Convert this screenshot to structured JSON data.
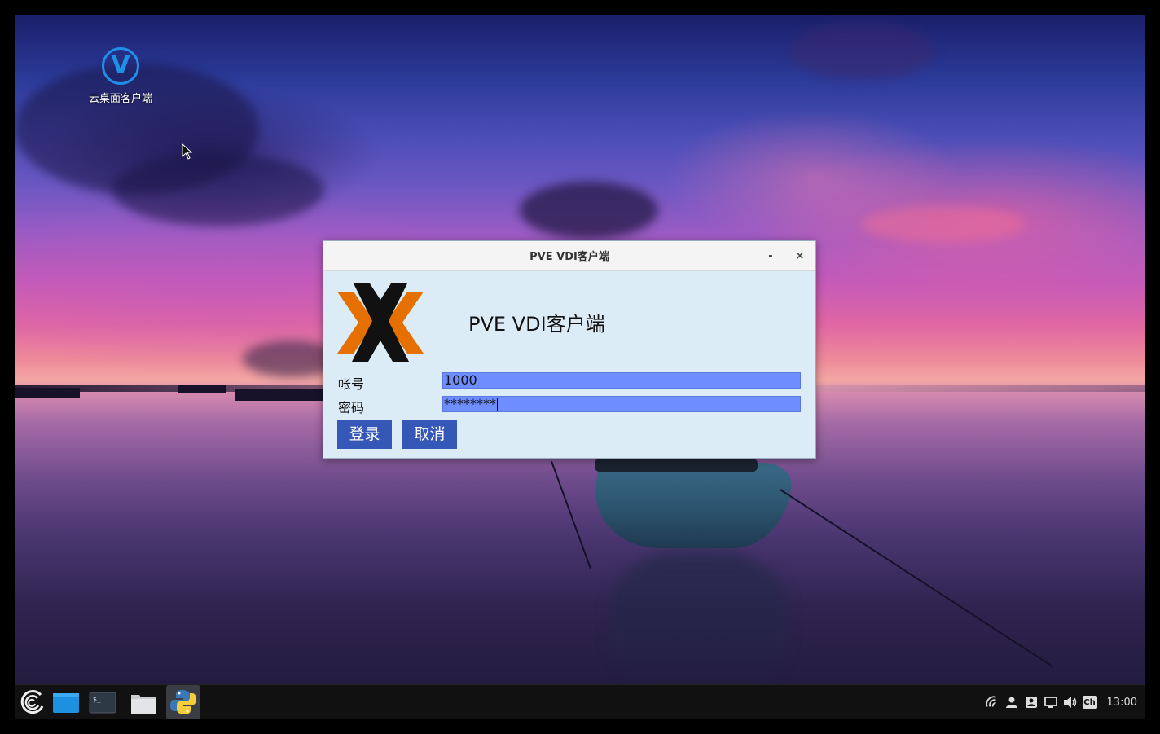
{
  "desktop": {
    "icon_label": "云桌面客户端",
    "icon_glyph": "V"
  },
  "dialog": {
    "window_title": "PVE VDI客户端",
    "minimize_glyph": "-",
    "close_glyph": "×",
    "heading": "PVE VDI客户端",
    "account_label": "帐号",
    "account_value": "1000",
    "password_label": "密码",
    "password_value": "********",
    "login_button": "登录",
    "cancel_button": "取消"
  },
  "taskbar": {
    "clock": "13:00",
    "input_method": "Ch",
    "launchers": [
      "menu-logo-icon",
      "desktop-icon",
      "terminal-icon",
      "file-manager-icon",
      "python-app-icon"
    ],
    "tray_icons": [
      "network-icon",
      "user-icon",
      "account-card-icon",
      "display-icon",
      "volume-icon",
      "input-method-icon"
    ]
  },
  "colors": {
    "field_bg": "#6e8eff",
    "button_bg": "#3557b8",
    "dialog_bg": "#dcecf6",
    "logo_orange": "#e57000",
    "accent_blue": "#1f8fe8"
  }
}
